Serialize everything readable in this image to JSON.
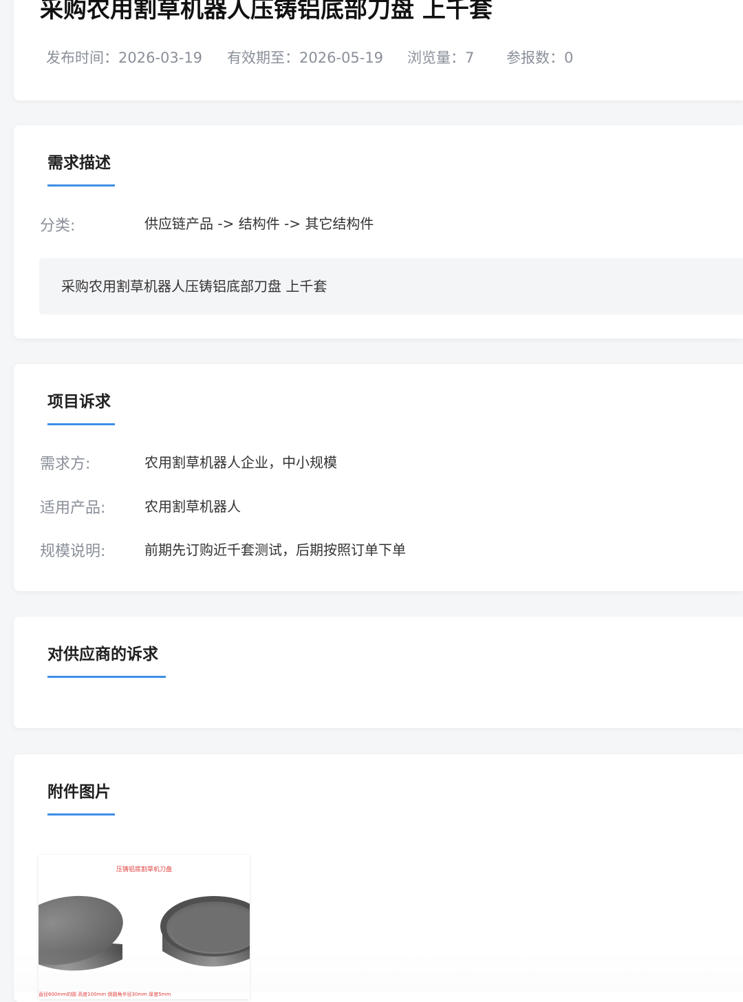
{
  "header": {
    "title": "采购农用割草机器人压铸铝底部刀盘 上千套",
    "publish_time": "发布时间：2026-03-19",
    "valid_until": "有效期至：2026-05-19",
    "views": "浏览量：7",
    "quotes": "参报数：0"
  },
  "requirement": {
    "heading": "需求描述",
    "category_label": "分类:",
    "category_value": "供应链产品 -> 结构件 -> 其它结构件",
    "description": "采购农用割草机器人压铸铝底部刀盘 上千套"
  },
  "project": {
    "heading": "项目诉求",
    "rows": [
      {
        "label": "需求方:",
        "value": "农用割草机器人企业，中小规模"
      },
      {
        "label": "适用产品:",
        "value": "农用割草机器人"
      },
      {
        "label": "规模说明:",
        "value": "前期先订购近千套测试，后期按照订单下单"
      }
    ]
  },
  "supplier": {
    "heading": "对供应商的诉求"
  },
  "attachments": {
    "heading": "附件图片",
    "image_caption": "压铸铝底割草机刀盘",
    "image_footer": "直径600mm的圆 高度100mm 倒圆角半径30mm 厚度5mm"
  },
  "colors": {
    "accent": "#3d8ee6",
    "background": "#f5f6f8",
    "label": "#8a8f99"
  }
}
